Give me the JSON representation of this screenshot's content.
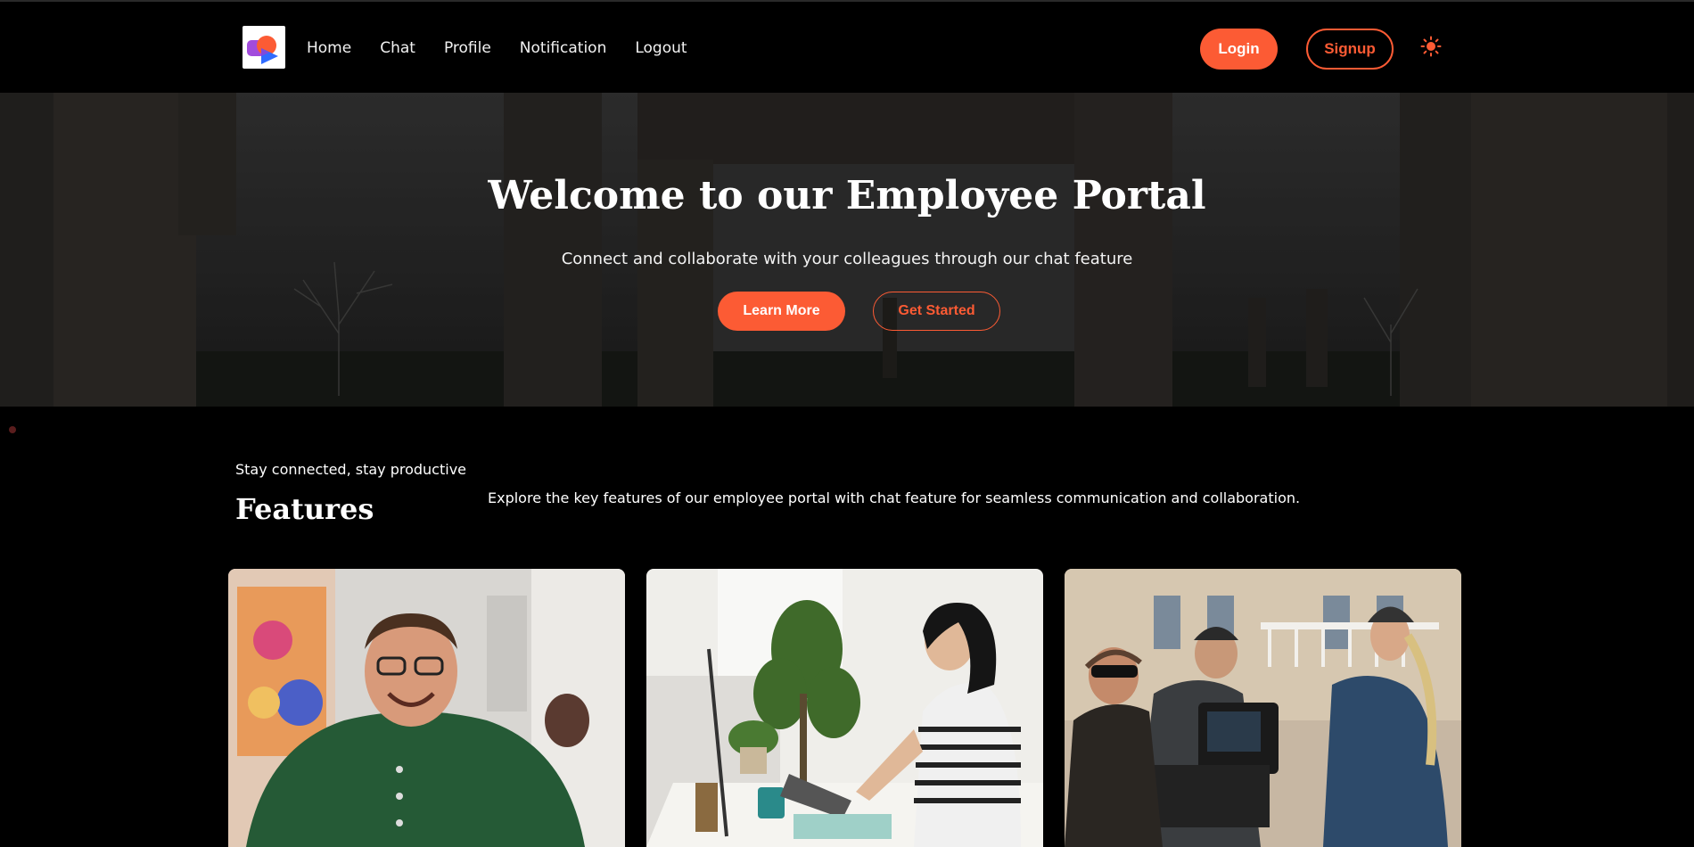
{
  "nav": {
    "links": [
      "Home",
      "Chat",
      "Profile",
      "Notification",
      "Logout"
    ],
    "login_label": "Login",
    "signup_label": "Signup",
    "logo_icon": "chat-bubbles-logo-icon",
    "theme_icon": "sun-icon"
  },
  "hero": {
    "title": "Welcome to our Employee Portal",
    "subtitle": "Connect and collaborate with your colleagues through our chat feature",
    "learn_more_label": "Learn More",
    "get_started_label": "Get Started"
  },
  "features": {
    "tagline": "Stay connected, stay productive",
    "title": "Features",
    "description": "Explore the key features of our employee portal with chat feature for seamless communication and collaboration."
  },
  "colors": {
    "accent": "#fc5b34",
    "background": "#000000"
  }
}
